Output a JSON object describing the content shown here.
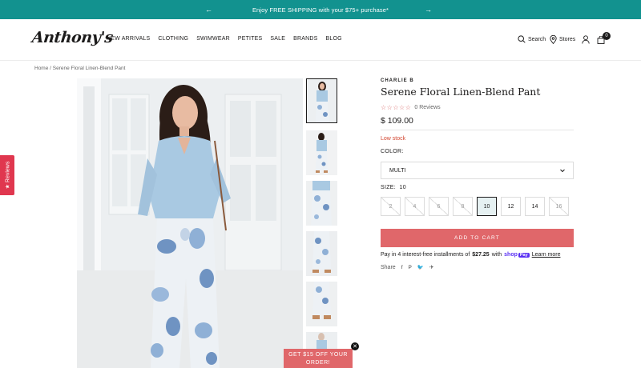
{
  "announcement": {
    "text": "Enjoy FREE SHIPPING with your $75+ purchase*",
    "prev_icon": "arrow-left-icon",
    "next_icon": "arrow-right-icon"
  },
  "header": {
    "logo": "Anthony's",
    "nav": [
      "NEW ARRIVALS",
      "CLOTHING",
      "SWIMWEAR",
      "PETITES",
      "SALE",
      "BRANDS",
      "BLOG"
    ],
    "search_label": "Search",
    "stores_label": "Stores",
    "cart_count": "0"
  },
  "breadcrumb": "Home / Serene Floral Linen-Blend Pant",
  "reviews_tab": "Reviews",
  "product": {
    "brand": "CHARLIE B",
    "title": "Serene Floral Linen-Blend Pant",
    "stars": "☆☆☆☆☆",
    "review_count": "0 Reviews",
    "price": "$ 109.00",
    "stock": "Low stock",
    "color_label": "COLOR:",
    "color_value": "MULTI",
    "size_label": "SIZE:",
    "size_selected": "10",
    "sizes": [
      "2",
      "4",
      "6",
      "8",
      "10",
      "12",
      "14",
      "16"
    ],
    "add_to_cart": "ADD TO CART",
    "installments_pre": "Pay in 4 interest-free installments of",
    "installments_amount": "$27.25",
    "installments_post": "with",
    "shop_label": "shop",
    "pay_label": "Pay",
    "learn_more": "Learn more",
    "share_label": "Share"
  },
  "promo": {
    "text": "GET $15 OFF YOUR ORDER!"
  },
  "colors": {
    "teal": "#12928f",
    "coral": "#e0676a",
    "reviews_red": "#e0374f",
    "low_stock": "#d2452f",
    "shop_pay": "#5a31f4"
  }
}
